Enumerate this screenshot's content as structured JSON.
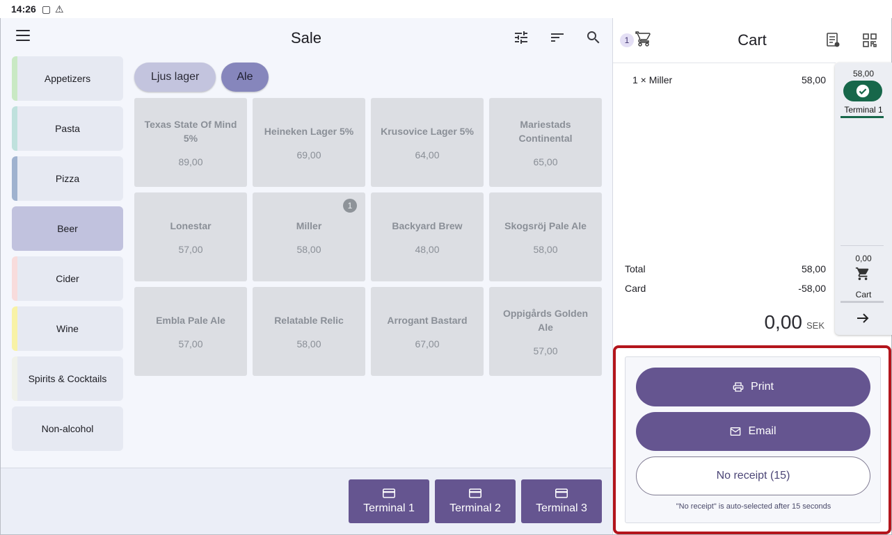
{
  "status_bar": {
    "time": "14:26"
  },
  "left": {
    "title": "Sale",
    "categories": [
      {
        "label": "Appetizers",
        "color": "#c9e9c4"
      },
      {
        "label": "Pasta",
        "color": "#bfe1dd"
      },
      {
        "label": "Pizza",
        "color": "#9fb2cf"
      },
      {
        "label": "Beer",
        "color": "#c1c2de",
        "active": true
      },
      {
        "label": "Cider",
        "color": "#f8dcdc"
      },
      {
        "label": "Wine",
        "color": "#f8f2a6"
      },
      {
        "label": "Spirits & Cocktails",
        "color": "#f0f2ea"
      },
      {
        "label": "Non-alcohol",
        "color": "#e6e9f2"
      }
    ],
    "chips": [
      "Ljus lager",
      "Ale"
    ],
    "products": [
      {
        "name": "Texas State Of Mind 5%",
        "price": "89,00"
      },
      {
        "name": "Heineken Lager 5%",
        "price": "69,00"
      },
      {
        "name": "Krusovice Lager 5%",
        "price": "64,00"
      },
      {
        "name": "Mariestads Continental",
        "price": "65,00"
      },
      {
        "name": "Lonestar",
        "price": "57,00"
      },
      {
        "name": "Miller",
        "price": "58,00",
        "badge": "1"
      },
      {
        "name": "Backyard Brew",
        "price": "48,00"
      },
      {
        "name": "Skogsröj Pale Ale",
        "price": "58,00"
      },
      {
        "name": "Embla Pale Ale",
        "price": "57,00"
      },
      {
        "name": "Relatable Relic",
        "price": "58,00"
      },
      {
        "name": "Arrogant Bastard",
        "price": "67,00"
      },
      {
        "name": "Oppigårds Golden Ale",
        "price": "57,00"
      }
    ],
    "terminals": [
      "Terminal 1",
      "Terminal 2",
      "Terminal 3"
    ]
  },
  "cart": {
    "title": "Cart",
    "count": "1",
    "item": {
      "qty": "1 ×",
      "name": "Miller",
      "price": "58,00"
    },
    "total_label": "Total",
    "total_value": "58,00",
    "card_label": "Card",
    "card_value": "-58,00",
    "remaining": "0,00",
    "currency": "SEK",
    "side": {
      "terminal_amount": "58,00",
      "terminal_label": "Terminal 1",
      "cart_amount": "0,00",
      "cart_label": "Cart"
    },
    "receipt": {
      "print_label": "Print",
      "email_label": "Email",
      "no_receipt_label": "No receipt (15)",
      "note": "\"No receipt\" is auto-selected after 15 seconds"
    }
  },
  "colors": {
    "primary": "#655590",
    "success": "#17674a",
    "highlight": "#b3151c"
  }
}
